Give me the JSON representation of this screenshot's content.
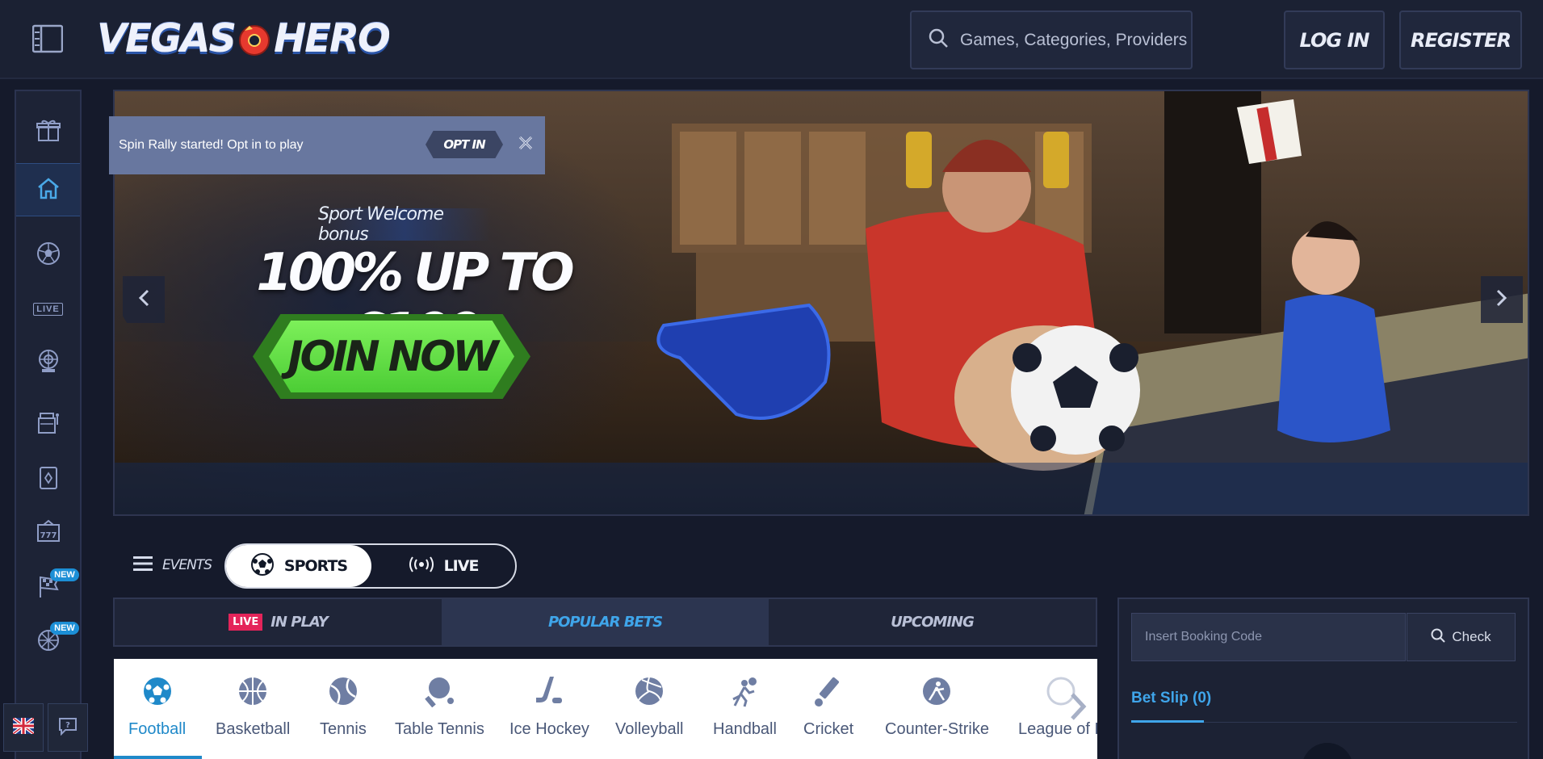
{
  "header": {
    "logo_text_left": "VEGAS",
    "logo_text_right": "HERO",
    "search_placeholder": "Games, Categories, Providers",
    "login_label": "LOG IN",
    "register_label": "REGISTER"
  },
  "sidebar": {
    "items": [
      {
        "icon": "gift-icon"
      },
      {
        "icon": "home-icon",
        "active": true
      },
      {
        "icon": "sports-ball-icon"
      },
      {
        "icon": "live-icon",
        "text": "LIVE"
      },
      {
        "icon": "live-casino-icon"
      },
      {
        "icon": "lottery-icon"
      },
      {
        "icon": "cards-icon"
      },
      {
        "icon": "slots-icon"
      },
      {
        "icon": "racing-flag-icon",
        "badge": "NEW"
      },
      {
        "icon": "wheel-icon",
        "badge": "NEW"
      }
    ],
    "language_icon": "uk-flag-icon",
    "help_icon": "chat-help-icon"
  },
  "banner": {
    "notification_text": "Spin Rally started! Opt in to play",
    "optin_label": "OPT IN",
    "promo_small": "Sport Welcome bonus",
    "promo_big": "100% UP TO €100",
    "cta_label": "JOIN NOW"
  },
  "events": {
    "label": "EVENTS",
    "sports_label": "SPORTS",
    "live_label": "LIVE"
  },
  "tabs": {
    "live_badge": "LIVE",
    "in_play": "IN PLAY",
    "popular_bets": "POPULAR BETS",
    "upcoming": "UPCOMING"
  },
  "sports": [
    "Football",
    "Basketball",
    "Tennis",
    "Table Tennis",
    "Ice Hockey",
    "Volleyball",
    "Handball",
    "Cricket",
    "Counter-Strike",
    "League of L"
  ],
  "betslip": {
    "booking_placeholder": "Insert Booking Code",
    "check_label": "Check",
    "title": "Bet Slip (0)"
  },
  "colors": {
    "accent": "#3fa5ea",
    "live_red": "#e4245a",
    "cta_green": "#4ccd35",
    "background": "#151a2b"
  }
}
